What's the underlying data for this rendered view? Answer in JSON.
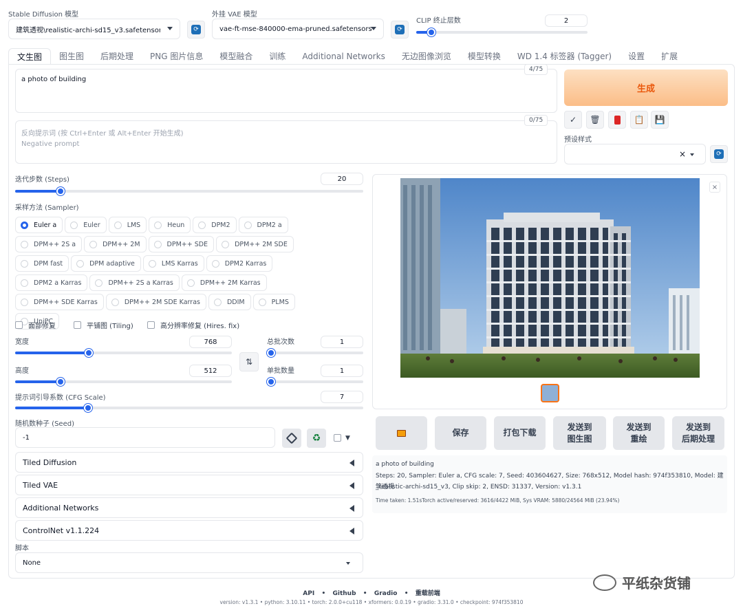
{
  "model": {
    "label": "Stable Diffusion 模型",
    "value": "建筑透视\\realistic-archi-sd15_v3.safetensors [9"
  },
  "vae": {
    "label": "外挂 VAE 模型",
    "value": "vae-ft-mse-840000-ema-pruned.safetensors"
  },
  "clip": {
    "label": "CLIP 终止层数",
    "value": "2",
    "level": 0.09
  },
  "tabs": [
    "文生图",
    "图生图",
    "后期处理",
    "PNG 图片信息",
    "模型融合",
    "训练",
    "Additional Networks",
    "无边图像浏览",
    "模型转换",
    "WD 1.4 标签器 (Tagger)",
    "设置",
    "扩展"
  ],
  "prompt": {
    "value": "a photo of building",
    "count": "4/75"
  },
  "negative": {
    "placeholder1": "反向提示词 (按 Ctrl+Enter 或 Alt+Enter 开始生成)",
    "placeholder2": "Negative prompt",
    "count": "0/75"
  },
  "generate": {
    "label": "生成",
    "color": "#f97316"
  },
  "style": {
    "label": "预设样式",
    "clear": "×"
  },
  "steps": {
    "label": "迭代步数 (Steps)",
    "value": "20",
    "level": 0.13
  },
  "sampler": {
    "label": "采样方法 (Sampler)",
    "options": [
      "Euler a",
      "Euler",
      "LMS",
      "Heun",
      "DPM2",
      "DPM2 a",
      "DPM++ 2S a",
      "DPM++ 2M",
      "DPM++ SDE",
      "DPM++ 2M SDE",
      "DPM fast",
      "DPM adaptive",
      "LMS Karras",
      "DPM2 Karras",
      "DPM2 a Karras",
      "DPM++ 2S a Karras",
      "DPM++ 2M Karras",
      "DPM++ SDE Karras",
      "DPM++ 2M SDE Karras",
      "DDIM",
      "PLMS",
      "UniPC"
    ],
    "selected": "Euler a"
  },
  "options": {
    "face": "面部修复",
    "tiling": "平铺图 (Tiling)",
    "hires": "高分辨率修复 (Hires. fix)"
  },
  "width": {
    "label": "宽度",
    "value": "768",
    "level": 0.34
  },
  "height": {
    "label": "高度",
    "value": "512",
    "level": 0.21
  },
  "batch_count": {
    "label": "总批次数",
    "value": "1",
    "level": 0.0
  },
  "batch_size": {
    "label": "单批数量",
    "value": "1",
    "level": 0.0
  },
  "cfg": {
    "label": "提示词引导系数 (CFG Scale)",
    "value": "7",
    "level": 0.21
  },
  "seed": {
    "label": "随机数种子 (Seed)",
    "value": "-1"
  },
  "accordions": [
    "Tiled Diffusion",
    "Tiled VAE",
    "Additional Networks",
    "ControlNet v1.1.224"
  ],
  "script": {
    "label": "脚本",
    "value": "None"
  },
  "actions": [
    "打开文件夹",
    "保存",
    "打包下载",
    "发送到\n图生图",
    "发送到\n重绘",
    "发送到\n后期处理"
  ],
  "info": {
    "prompt": "a photo of building",
    "params1": "Steps: 20, Sampler: Euler a, CFG scale: 7, Seed: 403604627, Size: 768x512, Model hash: 974f353810, Model: 建筑透视",
    "params2": "_realistic-archi-sd15_v3, Clip skip: 2, ENSD: 31337, Version: v1.3.1",
    "time": "Time taken: 1.51sTorch active/reserved: 3616/4422 MiB, Sys VRAM: 5880/24564 MiB (23.94%)"
  },
  "footer": {
    "links": [
      "API",
      "Github",
      "Gradio",
      "重载前端"
    ],
    "version": "version: v1.3.1  •  python: 3.10.11  •  torch: 2.0.0+cu118  •  xformers: 0.0.19  •  gradio: 3.31.0  •  checkpoint: 974f353810"
  },
  "watermark": "平纸杂货铺"
}
